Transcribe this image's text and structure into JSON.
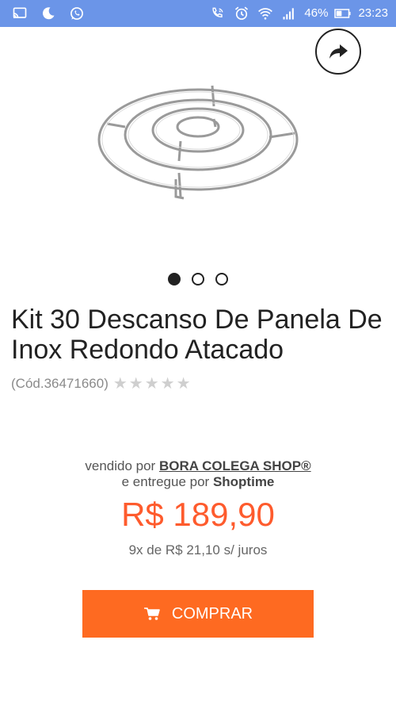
{
  "status_bar": {
    "left_icons": [
      "cast-icon",
      "moon-icon",
      "whatsapp-icon"
    ],
    "right_icons": [
      "phone-wifi-icon",
      "alarm-icon",
      "wifi-icon",
      "signal-icon",
      "battery-icon"
    ],
    "battery_percent": "46%",
    "time": "23:23"
  },
  "product": {
    "image_icon": "trivet-rack-image",
    "share_icon": "share-arrow-icon",
    "carousel": {
      "count": 3,
      "active_index": 0
    },
    "title": "Kit 30 Descanso De Panela De Inox Redondo Atacado",
    "code": "(Cód.36471660)",
    "rating": {
      "stars_filled": 0,
      "stars_total": 5,
      "stars_text": "★★★★★"
    }
  },
  "seller": {
    "sold_by_prefix": "vendido por",
    "seller_name": "BORA COLEGA SHOP®",
    "delivered_prefix": "e entregue por",
    "delivered_by": "Shoptime"
  },
  "pricing": {
    "price": "R$ 189,90",
    "installments": "9x de R$ 21,10 s/ juros"
  },
  "buy": {
    "label": "COMPRAR",
    "icon": "cart-icon"
  },
  "colors": {
    "status_bar": "#6b95e8",
    "accent": "#fe6a21",
    "price": "#fe5b2d"
  }
}
